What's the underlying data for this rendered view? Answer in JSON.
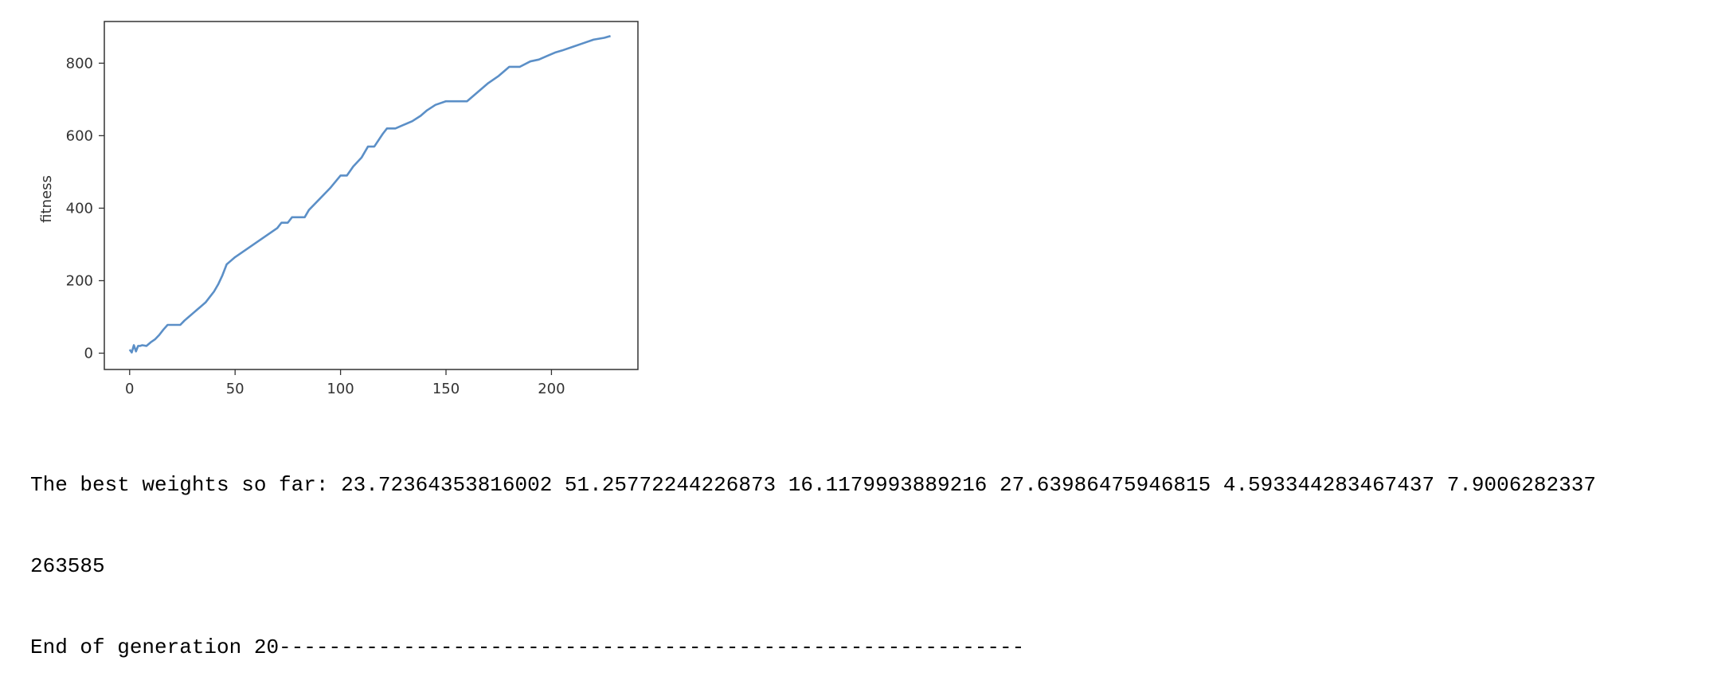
{
  "chart_data": {
    "type": "line",
    "title": "",
    "xlabel": "",
    "ylabel": "fitness",
    "xlim": [
      -12,
      241
    ],
    "ylim": [
      -45,
      915
    ],
    "xticks": [
      0,
      50,
      100,
      150,
      200
    ],
    "yticks": [
      0,
      200,
      400,
      600,
      800
    ],
    "grid": false,
    "legend": "none",
    "line_color": "#5b8fc7",
    "series": [
      {
        "x": [
          0,
          1,
          2,
          3,
          4,
          5,
          6,
          8,
          10,
          12,
          14,
          16,
          18,
          20,
          24,
          26,
          28,
          30,
          32,
          34,
          36,
          38,
          40,
          42,
          44,
          46,
          48,
          50,
          55,
          60,
          65,
          70,
          72,
          75,
          77,
          80,
          83,
          85,
          90,
          95,
          100,
          103,
          106,
          110,
          113,
          116,
          120,
          122,
          126,
          130,
          134,
          138,
          141,
          145,
          150,
          155,
          160,
          165,
          170,
          175,
          180,
          185,
          190,
          194,
          198,
          202,
          205,
          210,
          215,
          220,
          225,
          228
        ],
        "y": [
          10,
          2,
          22,
          5,
          20,
          20,
          22,
          20,
          30,
          38,
          50,
          65,
          78,
          78,
          78,
          90,
          100,
          110,
          120,
          130,
          140,
          155,
          170,
          190,
          215,
          245,
          255,
          265,
          285,
          305,
          325,
          345,
          360,
          360,
          375,
          375,
          375,
          395,
          425,
          455,
          490,
          490,
          515,
          540,
          570,
          570,
          605,
          620,
          620,
          630,
          640,
          655,
          670,
          685,
          695,
          695,
          695,
          720,
          745,
          765,
          790,
          790,
          805,
          810,
          820,
          830,
          835,
          845,
          855,
          865,
          870,
          875
        ]
      }
    ]
  },
  "output": {
    "line1": "The best weights so far: 23.72364353816002 51.25772244226873 16.1179993889216 27.63986475946815 4.593344283467437 7.9006282337",
    "line2": "263585",
    "line3": "End of generation 20------------------------------------------------------------"
  }
}
